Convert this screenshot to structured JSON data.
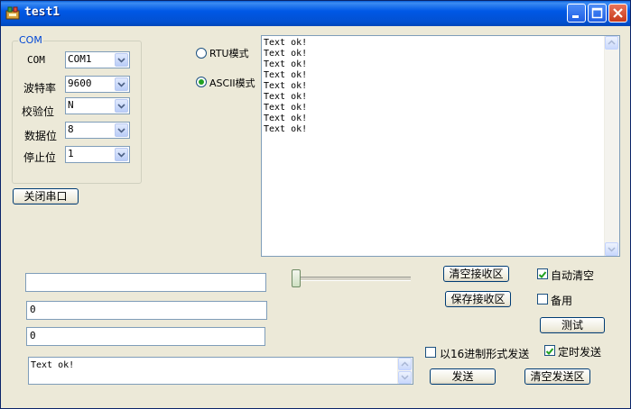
{
  "window": {
    "title": "test1"
  },
  "com_group": {
    "title": "COM",
    "fields": [
      {
        "label": "COM",
        "value": "COM1"
      },
      {
        "label": "波特率",
        "value": "9600"
      },
      {
        "label": "校验位",
        "value": "N"
      },
      {
        "label": "数据位",
        "value": "8"
      },
      {
        "label": "停止位",
        "value": "1"
      }
    ]
  },
  "close_port_button": "关闭串口",
  "modes": {
    "rtu": "RTU模式",
    "ascii": "ASCII模式",
    "selected": "ascii"
  },
  "receive": {
    "lines": [
      "Text ok!",
      "Text ok!",
      "Text ok!",
      "Text ok!",
      "Text ok!",
      "Text ok!",
      "Text ok!",
      "Text ok!",
      "Text ok!"
    ]
  },
  "inputs": {
    "field1": "",
    "field2": "0",
    "field3": "0"
  },
  "send_text": "Text ok!",
  "buttons": {
    "clear_receive": "清空接收区",
    "save_receive": "保存接收区",
    "test": "测试",
    "send": "发送",
    "clear_send": "清空发送区"
  },
  "checkboxes": {
    "auto_clear": {
      "label": "自动清空",
      "checked": true
    },
    "spare": {
      "label": "备用",
      "checked": false
    },
    "hex_send": {
      "label": "以16进制形式发送",
      "checked": false
    },
    "timed_send": {
      "label": "定时发送",
      "checked": true
    }
  },
  "slider": {
    "value": 0
  },
  "colors": {
    "titlebar": "#0058e6",
    "face": "#ece9d8",
    "group_title": "#0046d5",
    "check_mark": "#21a121"
  }
}
